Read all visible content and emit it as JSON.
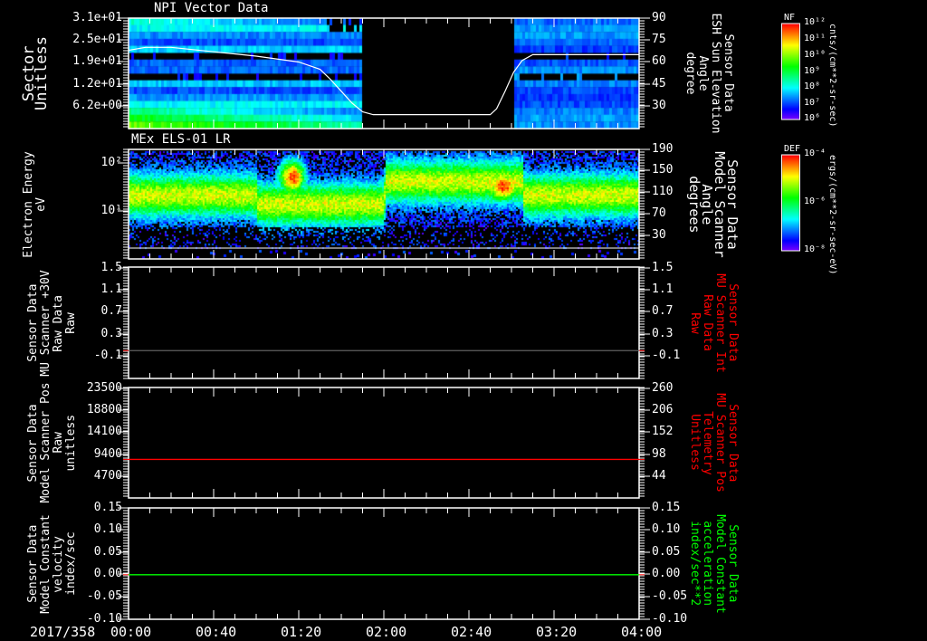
{
  "colors": {
    "background": "#000000",
    "axis": "#ffffff",
    "red_series": "#ff0000",
    "green_series": "#00ff00",
    "gray_series": "#606060"
  },
  "time_axis": {
    "date_label": "2017/358",
    "ticks": [
      "00:00",
      "00:40",
      "01:20",
      "02:00",
      "02:40",
      "03:20",
      "04:00"
    ],
    "range_minutes": [
      0,
      240
    ]
  },
  "chart_data": [
    {
      "type": "heatmap",
      "title": "NPI Vector Data",
      "ylabel": [
        "Sector",
        "Unitless"
      ],
      "ylim": [
        0,
        31
      ],
      "yticks": [
        "3.1e+01",
        "2.5e+01",
        "1.9e+01",
        "1.2e+01",
        "6.2e+00"
      ],
      "data_gap": [
        "01:50",
        "02:50"
      ],
      "colorbar": {
        "title": "NF",
        "ticks": [
          "10¹²",
          "10¹¹",
          "10¹⁰",
          "10⁹",
          "10⁸",
          "10⁷",
          "10⁶"
        ],
        "unit": "cnts/(cm**2-sr-sec)",
        "scale": "log"
      },
      "overlay_line": {
        "ylabel": [
          "Sensor Data",
          "ESH Sun Elevation",
          "Angle",
          "degree"
        ],
        "yticks": [
          "90",
          "75",
          "60",
          "45",
          "30"
        ],
        "ylim": [
          14.5,
          90
        ],
        "color": "#ffffff",
        "x": [
          "00:00",
          "00:08",
          "00:20",
          "00:40",
          "01:00",
          "01:10",
          "01:20",
          "01:30",
          "01:35",
          "01:40",
          "01:45",
          "01:50",
          "01:55",
          "02:50",
          "02:53",
          "02:57",
          "03:01",
          "03:05",
          "03:10",
          "04:00"
        ],
        "y": [
          68,
          70,
          70,
          67,
          64,
          62,
          60,
          55,
          48,
          40,
          32,
          26,
          24,
          24,
          28,
          40,
          53,
          61,
          65,
          65
        ]
      }
    },
    {
      "type": "heatmap",
      "title": "MEx ELS-01 LR",
      "ylabel": [
        "Electron Energy",
        "eV"
      ],
      "yscale": "log",
      "yticks": [
        "10²",
        "10¹"
      ],
      "right_ylabel": [
        "Sensor Data",
        "Model Scanner",
        "Angle",
        "degrees"
      ],
      "right_yticks": [
        "190",
        "150",
        "110",
        "70",
        "30"
      ],
      "colorbar": {
        "title": "DEF",
        "ticks": [
          "10⁻⁴",
          "10⁻⁶",
          "10⁻⁸"
        ],
        "unit": "ergs/(cm**2-sr-sec-eV)",
        "scale": "log"
      }
    },
    {
      "type": "line",
      "ylabel": [
        "Sensor Data",
        "MU Scanner +30V",
        "Raw Data",
        "Raw"
      ],
      "yticks": [
        "1.5",
        "1.1",
        "0.7",
        "0.3",
        "-0.1"
      ],
      "ylim": [
        -0.5,
        1.5
      ],
      "right_ylabel": [
        "Sensor Data",
        "MU Scanner Int",
        "Raw Data",
        "Raw"
      ],
      "right_yticks": [
        "1.5",
        "1.1",
        "0.7",
        "0.3",
        "-0.1"
      ],
      "series": [
        {
          "x": [
            "00:00",
            "04:00"
          ],
          "y": [
            0.0,
            0.0
          ],
          "color": "#606060"
        }
      ]
    },
    {
      "type": "line",
      "ylabel": [
        "Sensor Data",
        "Model Scanner Pos",
        "Raw",
        "unitless"
      ],
      "yticks": [
        "23500",
        "18800",
        "14100",
        "9400",
        "4700"
      ],
      "ylim": [
        0,
        23500
      ],
      "right_ylabel": [
        "Sensor Data",
        "MU Scanner Pos",
        "Telemetry",
        "Unitless"
      ],
      "right_yticks": [
        "260",
        "206",
        "152",
        "98",
        "44"
      ],
      "series": [
        {
          "x": [
            "00:00",
            "04:00"
          ],
          "y": [
            8200,
            8200
          ],
          "color": "#ff0000"
        }
      ]
    },
    {
      "type": "line",
      "ylabel": [
        "Sensor Data",
        "Model Constant",
        "velocity",
        "index/sec"
      ],
      "yticks": [
        "0.15",
        "0.10",
        "0.05",
        "0.00",
        "-0.05",
        "-0.10"
      ],
      "ylim": [
        -0.1,
        0.15
      ],
      "right_ylabel": [
        "Sensor Data",
        "Model Constant",
        "acceleration",
        "index/sec**2"
      ],
      "right_yticks": [
        "0.15",
        "0.10",
        "0.05",
        "0.00",
        "-0.05",
        "-0.10"
      ],
      "series": [
        {
          "x": [
            "00:00",
            "04:00"
          ],
          "y": [
            0.0,
            0.0
          ],
          "color": "#00ff00"
        }
      ]
    }
  ]
}
